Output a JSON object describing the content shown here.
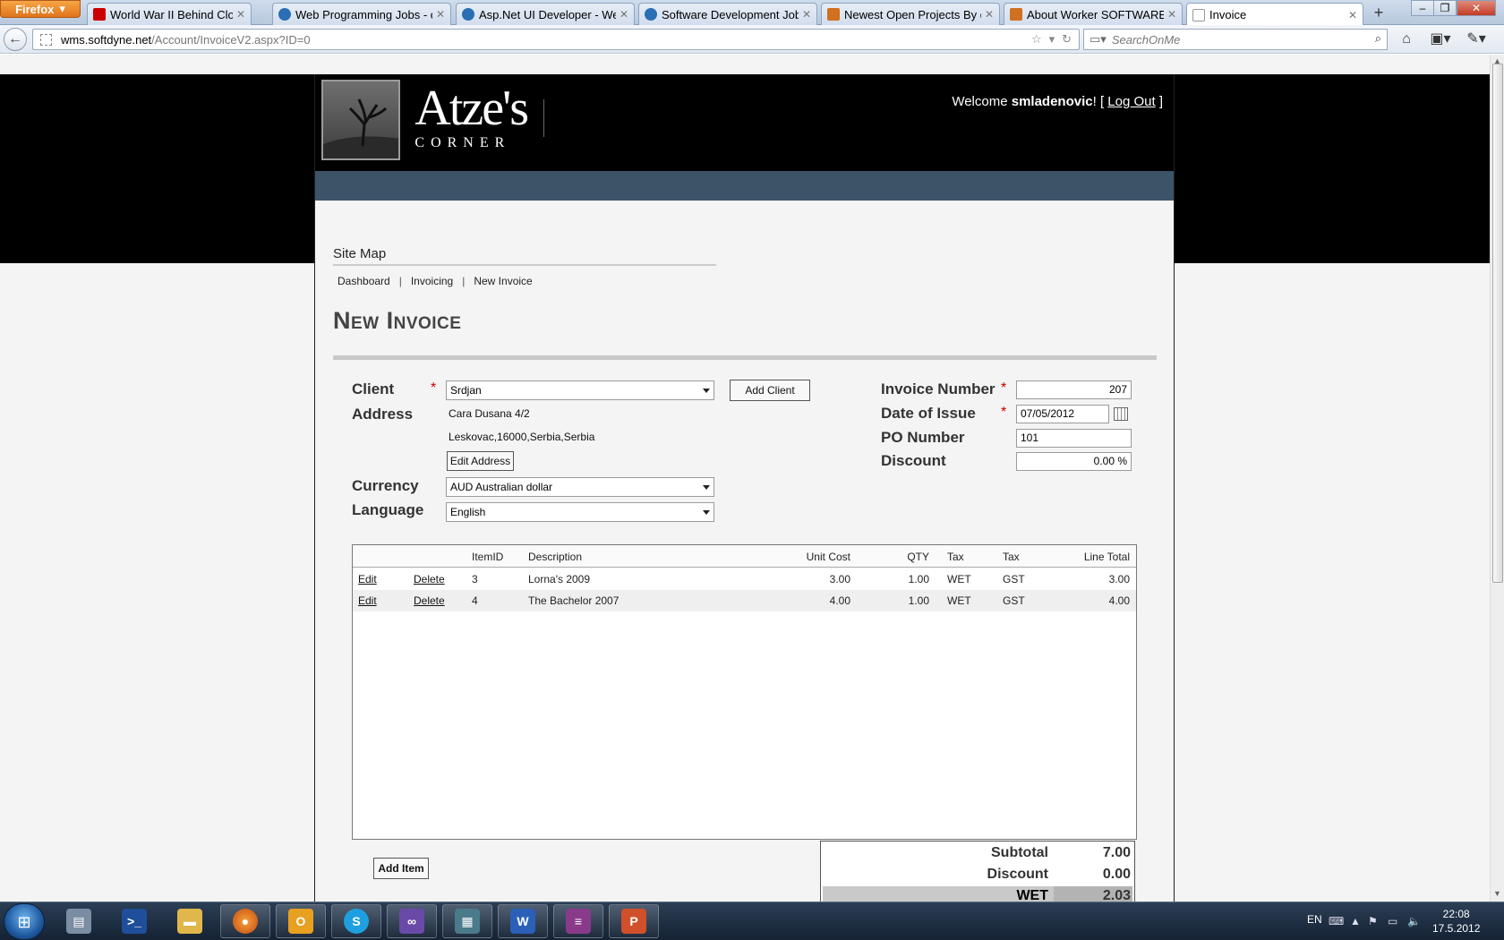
{
  "browser": {
    "menu_label": "Firefox",
    "tabs": [
      {
        "title": "World War II Behind Closed ...",
        "favicon_color": "#cc0000"
      },
      {
        "title": "Web Programming Jobs - o...",
        "favicon_color": "#2a6fb5"
      },
      {
        "title": "Asp.Net UI Developer - Web ...",
        "favicon_color": "#2a6fb5"
      },
      {
        "title": "Software Development Jobs ...",
        "favicon_color": "#2a6fb5"
      },
      {
        "title": "Newest Open Projects By dat...",
        "favicon_color": "#d07020"
      },
      {
        "title": "About Worker SOFTWARE D...",
        "favicon_color": "#d07020"
      },
      {
        "title": "Invoice",
        "favicon_color": "#ffffff"
      }
    ],
    "url_domain": "wms.softdyne.net",
    "url_path": "/Account/InvoiceV2.aspx?ID=0",
    "search_placeholder": "SearchOnMe"
  },
  "header": {
    "logo_title": "Atze's",
    "logo_subtitle": "CORNER",
    "welcome_prefix": "Welcome ",
    "username": "smladenovic",
    "welcome_mid": "! [ ",
    "logout_label": "Log Out",
    "welcome_suffix": " ]"
  },
  "sitemap": {
    "title": "Site Map",
    "crumbs": [
      "Dashboard",
      "Invoicing",
      "New Invoice"
    ]
  },
  "page_title": "New Invoice",
  "form": {
    "client_label": "Client",
    "client_value": "Srdjan",
    "add_client_label": "Add Client",
    "address_label": "Address",
    "address_line1": "Cara Dusana 4/2",
    "address_line2": "Leskovac,16000,Serbia,Serbia",
    "edit_address_label": "Edit Address",
    "currency_label": "Currency",
    "currency_value": "AUD Australian dollar",
    "language_label": "Language",
    "language_value": "English",
    "invoice_number_label": "Invoice Number",
    "invoice_number_value": "207",
    "date_label": "Date of Issue",
    "date_value": "07/05/2012",
    "po_label": "PO Number",
    "po_value": "101",
    "discount_label": "Discount",
    "discount_value": "0.00 %",
    "required_mark": "*"
  },
  "grid": {
    "headers": [
      "ItemID",
      "Description",
      "Unit Cost",
      "QTY",
      "Tax",
      "Tax",
      "Line Total"
    ],
    "rows": [
      {
        "edit": "Edit",
        "delete": "Delete",
        "item_id": "3",
        "description": "Lorna's 2009",
        "unit_cost": "3.00",
        "qty": "1.00",
        "tax1": "WET",
        "tax2": "GST",
        "line_total": "3.00"
      },
      {
        "edit": "Edit",
        "delete": "Delete",
        "item_id": "4",
        "description": "The Bachelor 2007",
        "unit_cost": "4.00",
        "qty": "1.00",
        "tax1": "WET",
        "tax2": "GST",
        "line_total": "4.00"
      }
    ]
  },
  "add_item_label": "Add Item",
  "totals": {
    "subtotal_label": "Subtotal",
    "subtotal_value": "7.00",
    "discount_label": "Discount",
    "discount_value": "0.00",
    "wet_label": "WET",
    "wet_value": "2.03"
  },
  "taskbar": {
    "language": "EN",
    "time": "22:08",
    "date": "17.5.2012"
  }
}
